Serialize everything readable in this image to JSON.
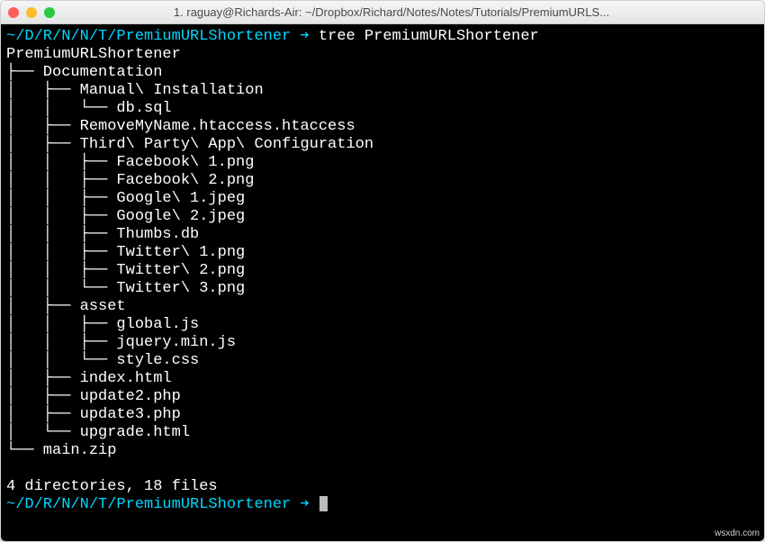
{
  "window": {
    "title": "1. raguay@Richards-Air: ~/Dropbox/Richard/Notes/Notes/Tutorials/PremiumURLS..."
  },
  "prompt1": {
    "path": "~/D/R/N/N/T/PremiumURLShortener",
    "arrow": "➔",
    "command": "tree PremiumURLShortener"
  },
  "tree": {
    "root": "PremiumURLShortener",
    "l0a": "├── Documentation",
    "l1a": "│   ├── Manual\\ Installation",
    "l2a": "│   │   └── db.sql",
    "l1b": "│   ├── RemoveMyName.htaccess.htaccess",
    "l1c": "│   ├── Third\\ Party\\ App\\ Configuration",
    "l2b": "│   │   ├── Facebook\\ 1.png",
    "l2c": "│   │   ├── Facebook\\ 2.png",
    "l2d": "│   │   ├── Google\\ 1.jpeg",
    "l2e": "│   │   ├── Google\\ 2.jpeg",
    "l2f": "│   │   ├── Thumbs.db",
    "l2g": "│   │   ├── Twitter\\ 1.png",
    "l2h": "│   │   ├── Twitter\\ 2.png",
    "l2i": "│   │   └── Twitter\\ 3.png",
    "l1d": "│   ├── asset",
    "l2j": "│   │   ├── global.js",
    "l2k": "│   │   ├── jquery.min.js",
    "l2l": "│   │   └── style.css",
    "l1e": "│   ├── index.html",
    "l1f": "│   ├── update2.php",
    "l1g": "│   ├── update3.php",
    "l1h": "│   └── upgrade.html",
    "l0b": "└── main.zip"
  },
  "summary": "4 directories, 18 files",
  "prompt2": {
    "path": "~/D/R/N/N/T/PremiumURLShortener",
    "arrow": "➔"
  },
  "watermark": "wsxdn.com"
}
